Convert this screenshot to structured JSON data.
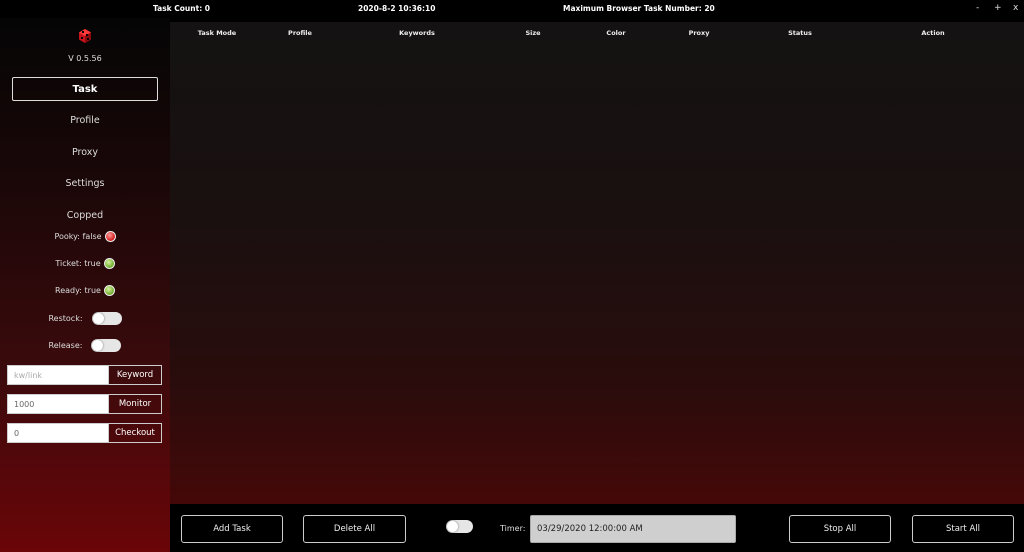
{
  "topbar": {
    "task_count": "Task Count: 0",
    "datetime": "2020-8-2 10:36:10",
    "max_browser": "Maximum Browser Task Number: 20",
    "minimize": "-",
    "maximize": "+",
    "close": "x"
  },
  "sidebar": {
    "logo_icon": "cube-logo",
    "version": "V 0.5.56",
    "nav": {
      "task": "Task",
      "profile": "Profile",
      "proxy": "Proxy",
      "settings": "Settings",
      "copped": "Copped"
    },
    "status": {
      "pooky": "Pooky: false",
      "ticket": "Ticket: true",
      "ready": "Ready: true"
    },
    "toggles": {
      "restock": "Restock:",
      "release": "Release:"
    },
    "inputs": {
      "keyword_placeholder": "kw/link",
      "keyword_button": "Keyword",
      "monitor_value": "1000",
      "monitor_button": "Monitor",
      "checkout_value": "0",
      "checkout_button": "Checkout"
    }
  },
  "table": {
    "columns": [
      "Task Mode",
      "Profile",
      "Keywords",
      "Size",
      "Color",
      "Proxy",
      "Status",
      "Action"
    ]
  },
  "bottombar": {
    "add_task": "Add Task",
    "delete_all": "Delete All",
    "timer_label": "Timer:",
    "timer_value": "03/29/2020 12:00:00 AM",
    "stop_all": "Stop All",
    "start_all": "Start All"
  },
  "colors": {
    "accent_red": "#d11a1a",
    "ok_green": "#6ea82a"
  }
}
